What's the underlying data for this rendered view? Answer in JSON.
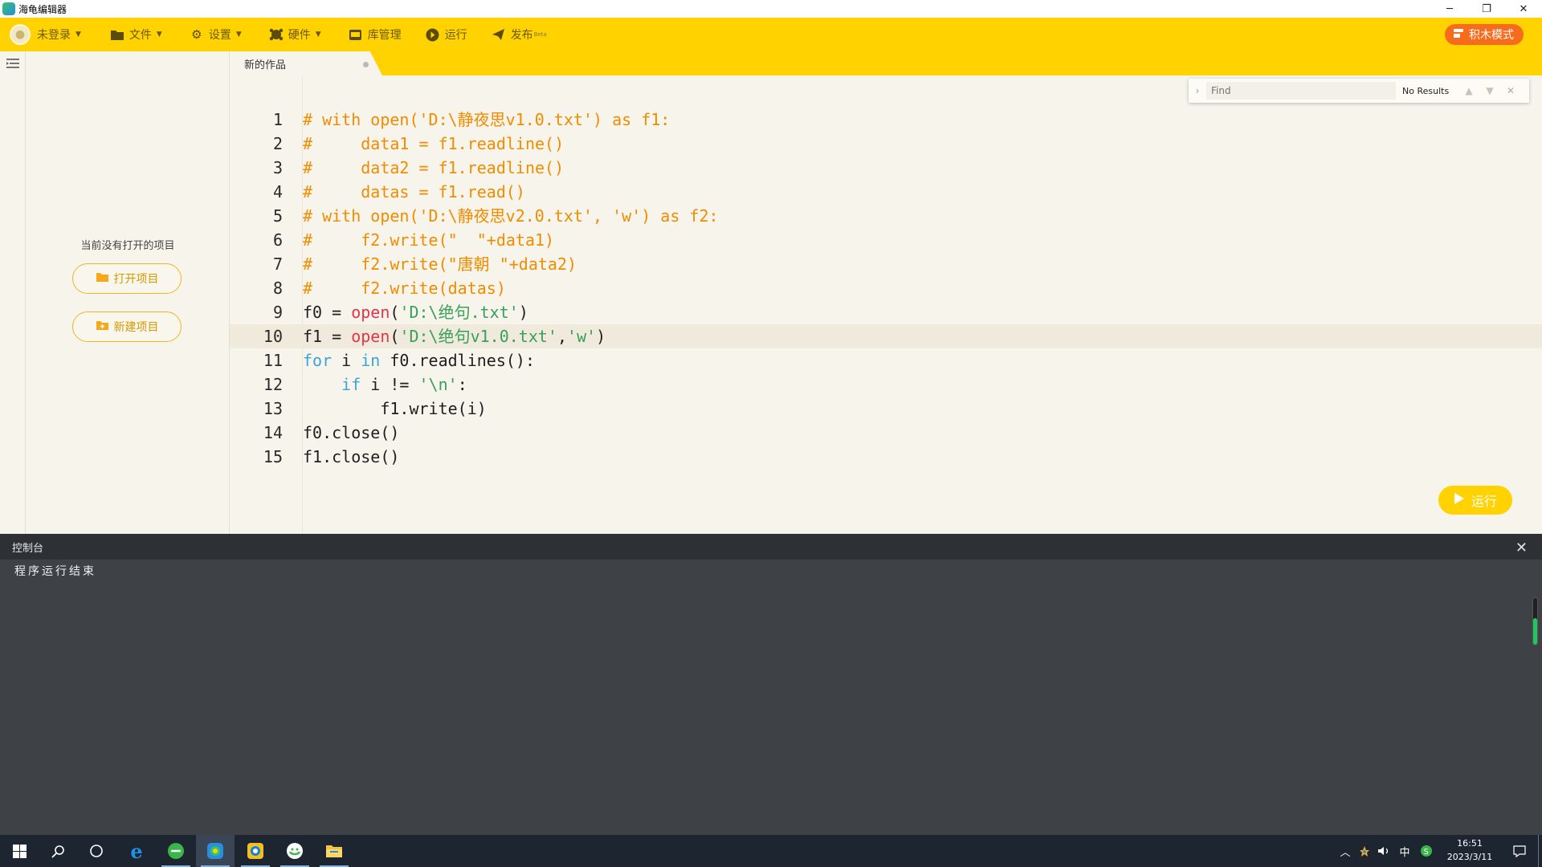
{
  "window": {
    "title": "海龟编辑器"
  },
  "toolbar": {
    "user_label": "未登录",
    "items": [
      {
        "label": "文件",
        "icon": "folder-icon",
        "has_caret": true
      },
      {
        "label": "设置",
        "icon": "gear-icon",
        "has_caret": true
      },
      {
        "label": "硬件",
        "icon": "hardware-icon",
        "has_caret": true
      },
      {
        "label": "库管理",
        "icon": "library-icon",
        "has_caret": false
      },
      {
        "label": "运行",
        "icon": "play-circle-icon",
        "has_caret": false
      },
      {
        "label": "发布",
        "icon": "send-icon",
        "has_caret": false,
        "badge": "Beta"
      }
    ],
    "block_mode_label": "积木模式"
  },
  "tab": {
    "label": "新的作品"
  },
  "project_panel": {
    "empty_text": "当前没有打开的项目",
    "open_button": "打开项目",
    "new_button": "新建项目"
  },
  "find": {
    "placeholder": "Find",
    "result": "No Results"
  },
  "editor": {
    "active_line": 10,
    "lines": [
      {
        "n": "1",
        "tokens": [
          {
            "t": "# with open('D:\\静夜思v1.0.txt') as f1:",
            "c": "cm"
          }
        ]
      },
      {
        "n": "2",
        "tokens": [
          {
            "t": "#     data1 = f1.readline()",
            "c": "cm"
          }
        ]
      },
      {
        "n": "3",
        "tokens": [
          {
            "t": "#     data2 = f1.readline()",
            "c": "cm"
          }
        ]
      },
      {
        "n": "4",
        "tokens": [
          {
            "t": "#     datas = f1.read()",
            "c": "cm"
          }
        ]
      },
      {
        "n": "5",
        "tokens": [
          {
            "t": "# with open('D:\\静夜思v2.0.txt', 'w') as f2:",
            "c": "cm"
          }
        ]
      },
      {
        "n": "6",
        "tokens": [
          {
            "t": "#     f2.write(\"  \"+data1)",
            "c": "cm"
          }
        ]
      },
      {
        "n": "7",
        "tokens": [
          {
            "t": "#     f2.write(\"唐朝 \"+data2)",
            "c": "cm"
          }
        ]
      },
      {
        "n": "8",
        "tokens": [
          {
            "t": "#     f2.write(datas)",
            "c": "cm"
          }
        ]
      },
      {
        "n": "9",
        "tokens": [
          {
            "t": "f0 = ",
            "c": "tx"
          },
          {
            "t": "open",
            "c": "fn"
          },
          {
            "t": "(",
            "c": "tx"
          },
          {
            "t": "'D:\\绝句.txt'",
            "c": "st"
          },
          {
            "t": ")",
            "c": "tx"
          }
        ]
      },
      {
        "n": "10",
        "tokens": [
          {
            "t": "f1 = ",
            "c": "tx"
          },
          {
            "t": "open",
            "c": "fn"
          },
          {
            "t": "(",
            "c": "tx"
          },
          {
            "t": "'D:\\绝句v1.0.txt'",
            "c": "st"
          },
          {
            "t": ",",
            "c": "tx"
          },
          {
            "t": "'w'",
            "c": "st"
          },
          {
            "t": ")",
            "c": "tx"
          }
        ]
      },
      {
        "n": "11",
        "tokens": [
          {
            "t": "for",
            "c": "kw"
          },
          {
            "t": " i ",
            "c": "tx"
          },
          {
            "t": "in",
            "c": "kw"
          },
          {
            "t": " f0.readlines():",
            "c": "tx"
          }
        ]
      },
      {
        "n": "12",
        "tokens": [
          {
            "t": "    ",
            "c": "tx"
          },
          {
            "t": "if",
            "c": "kw"
          },
          {
            "t": " i != ",
            "c": "tx"
          },
          {
            "t": "'\\n'",
            "c": "st"
          },
          {
            "t": ":",
            "c": "tx"
          }
        ]
      },
      {
        "n": "13",
        "tokens": [
          {
            "t": "        f1.write(i)",
            "c": "tx"
          }
        ]
      },
      {
        "n": "14",
        "tokens": [
          {
            "t": "f0.close()",
            "c": "tx"
          }
        ]
      },
      {
        "n": "15",
        "tokens": [
          {
            "t": "f1.close()",
            "c": "tx"
          }
        ]
      }
    ]
  },
  "run_button": {
    "label": "运行"
  },
  "console": {
    "title": "控制台",
    "output": "程序运行结束"
  },
  "taskbar": {
    "time": "16:51",
    "date": "2023/3/11",
    "ime": "中"
  },
  "colors": {
    "toolbar": "#ffd200",
    "block_mode": "#f76b1c",
    "comment": "#f08c00",
    "keyword": "#3ba4d8",
    "builtin": "#e3344b",
    "string": "#38a05a"
  }
}
